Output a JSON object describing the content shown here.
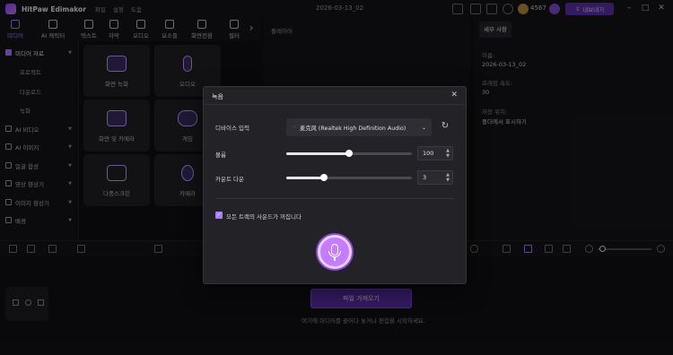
{
  "titlebar": {
    "app_name": "HitPaw Edimakor",
    "menus": [
      "파일",
      "설정",
      "도움"
    ],
    "project_name": "2026-03-13_02",
    "credits": "4567",
    "export_label": "내보내기"
  },
  "tool_tabs": [
    {
      "label": "미디어",
      "icon": "media-icon",
      "active": true
    },
    {
      "label": "AI 캐릭터",
      "icon": "ai-character-icon"
    },
    {
      "label": "텍스트",
      "icon": "text-icon"
    },
    {
      "label": "자막",
      "icon": "subtitle-icon"
    },
    {
      "label": "오디오",
      "icon": "audio-icon"
    },
    {
      "label": "요소들",
      "icon": "elements-icon"
    },
    {
      "label": "화면전환",
      "icon": "transition-icon"
    },
    {
      "label": "필터",
      "icon": "filter-icon"
    }
  ],
  "sidebar": {
    "section": "미디어 자료",
    "sub_items": [
      "프로젝트",
      "다운로드",
      "녹화"
    ],
    "items": [
      {
        "label": "AI 비디오"
      },
      {
        "label": "AI 이미지"
      },
      {
        "label": "얼굴 합성"
      },
      {
        "label": "영상 향상기"
      },
      {
        "label": "이미지 향상기"
      },
      {
        "label": "배경"
      }
    ]
  },
  "capture_cards": [
    {
      "label": "화면 녹화",
      "icon": "screen-record-icon"
    },
    {
      "label": "오디오",
      "icon": "microphone-icon"
    },
    {
      "label": "화면 및 카메라",
      "icon": "screen-camera-icon"
    },
    {
      "label": "게임",
      "icon": "gamepad-icon"
    },
    {
      "label": "다중스크린",
      "icon": "multiscreen-icon"
    },
    {
      "label": "카메라",
      "icon": "webcam-icon"
    }
  ],
  "player": {
    "title": "플레이어"
  },
  "details": {
    "tab": "세부 사항",
    "name_label": "이름:",
    "name_value": "2026-03-13_02",
    "fps_label": "프레임 속도:",
    "fps_value": "30",
    "storage_label": "저장 위치:",
    "storage_value": "폴더에서 표시하기"
  },
  "timeline": {
    "import_button": "파일 가져오기",
    "hint": "여기에 미디어를 끌어다 놓거나 편집을 시작하세요."
  },
  "dialog": {
    "title": "녹음",
    "device_label": "디바이스 입력",
    "device_value": "麦克风 (Realtek High Definition Audio)",
    "volume_label": "볼륨",
    "volume_value": "100",
    "volume_level": 0.5,
    "countdown_label": "카운트 다운",
    "countdown_value": "3",
    "countdown_level": 0.3,
    "mute_checkbox_label": "모든 트랙의 사운드가 꺼집니다",
    "mute_checked": true
  },
  "colors": {
    "accent": "#a97cff",
    "record_button": "#c67cff",
    "import_button": "#5b2ea6"
  }
}
